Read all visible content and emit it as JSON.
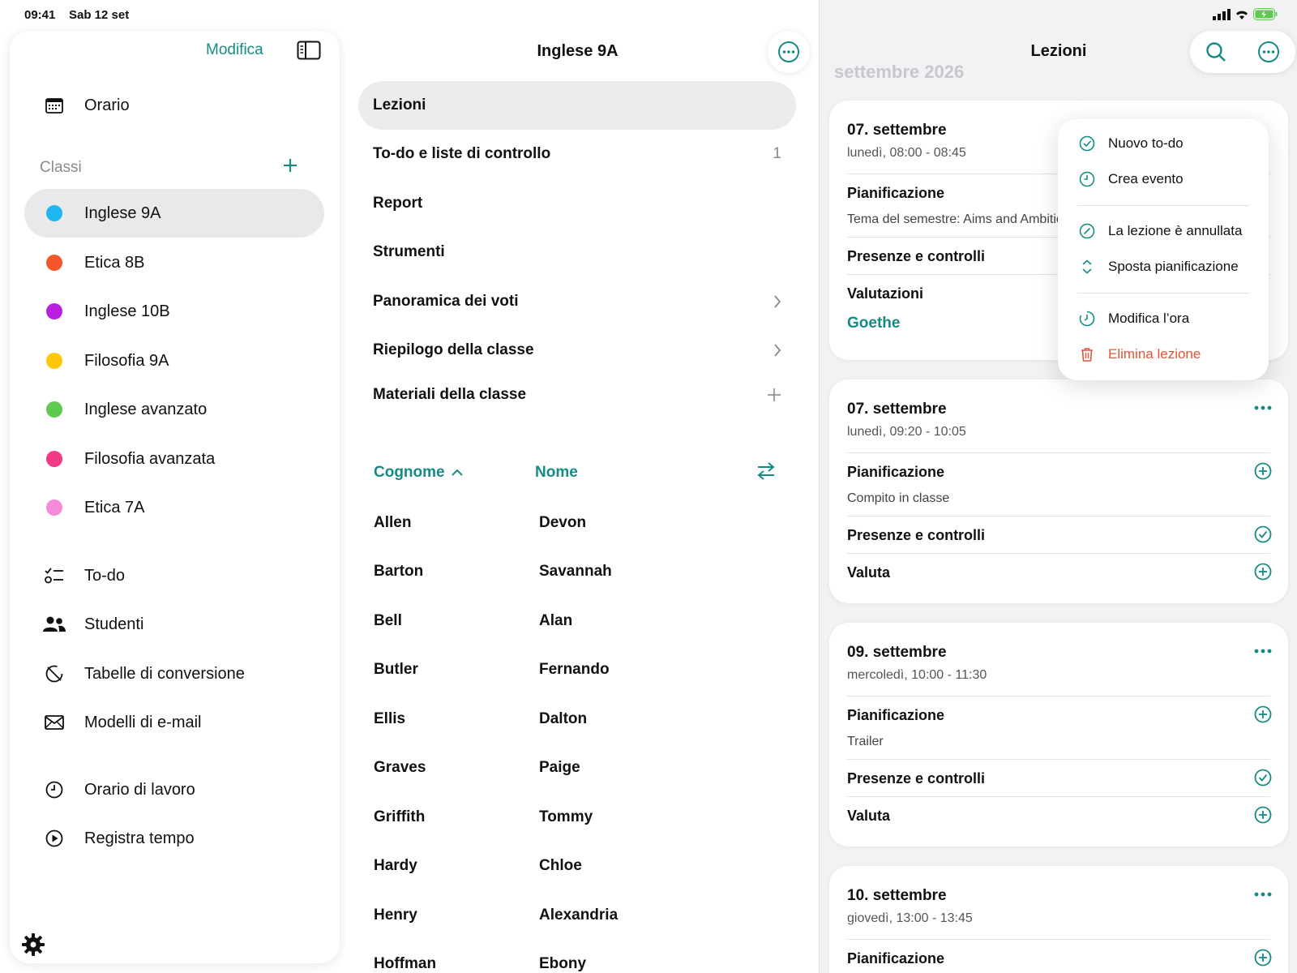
{
  "status": {
    "time": "09:41",
    "date": "Sab 12 set"
  },
  "sidebar": {
    "edit_label": "Modifica",
    "top_items": [
      {
        "label": "Orario",
        "icon": "calendar-icon"
      }
    ],
    "classes_title": "Classi",
    "classes": [
      {
        "label": "Inglese 9A",
        "color": "#1eb5f0",
        "selected": true
      },
      {
        "label": "Etica 8B",
        "color": "#f5562a"
      },
      {
        "label": "Inglese 10B",
        "color": "#b81fe0"
      },
      {
        "label": "Filosofia 9A",
        "color": "#ffc60a"
      },
      {
        "label": "Inglese avanzato",
        "color": "#5ecb50"
      },
      {
        "label": "Filosofia avanzata",
        "color": "#f23a86"
      },
      {
        "label": "Etica 7A",
        "color": "#f58bd8"
      }
    ],
    "tools": [
      {
        "label": "To-do",
        "icon": "checklist-icon"
      },
      {
        "label": "Studenti",
        "icon": "people-icon"
      },
      {
        "label": "Tabelle di conversione",
        "icon": "conversion-icon"
      },
      {
        "label": "Modelli di e-mail",
        "icon": "envelope-icon"
      }
    ],
    "time_items": [
      {
        "label": "Orario di lavoro",
        "icon": "clock-icon"
      },
      {
        "label": "Registra tempo",
        "icon": "play-icon"
      }
    ]
  },
  "middle": {
    "title": "Inglese 9A",
    "menu": [
      {
        "label": "Lezioni",
        "selected": true
      },
      {
        "label": "To-do e liste di controllo",
        "count": "1"
      },
      {
        "label": "Report"
      },
      {
        "label": "Strumenti"
      },
      {
        "label": "Panoramica dei voti"
      },
      {
        "label": "Riepilogo della classe"
      },
      {
        "label": "Materiali della classe"
      }
    ],
    "columns": {
      "last": "Cognome",
      "first": "Nome"
    },
    "students": [
      {
        "last": "Allen",
        "first": "Devon"
      },
      {
        "last": "Barton",
        "first": "Savannah"
      },
      {
        "last": "Bell",
        "first": "Alan"
      },
      {
        "last": "Butler",
        "first": "Fernando"
      },
      {
        "last": "Ellis",
        "first": "Dalton"
      },
      {
        "last": "Graves",
        "first": "Paige"
      },
      {
        "last": "Griffith",
        "first": "Tommy"
      },
      {
        "last": "Hardy",
        "first": "Chloe"
      },
      {
        "last": "Henry",
        "first": "Alexandria"
      },
      {
        "last": "Hoffman",
        "first": "Ebony"
      }
    ]
  },
  "right": {
    "title": "Lezioni",
    "month": "settembre 2026",
    "lessons": [
      {
        "date": "07. settembre",
        "time": "lunedì, 08:00 - 08:45",
        "planning_label": "Pianificazione",
        "planning_text": "Tema del semestre: Aims and Ambitions",
        "attendance_label": "Presenze e controlli",
        "grade_label": "Valutazioni",
        "grade_link": "Goethe"
      },
      {
        "date": "07. settembre",
        "time": "lunedì, 09:20 - 10:05",
        "planning_label": "Pianificazione",
        "planning_text": "Compito in classe",
        "attendance_label": "Presenze e controlli",
        "grade_label": "Valuta"
      },
      {
        "date": "09. settembre",
        "time": "mercoledì, 10:00 - 11:30",
        "planning_label": "Pianificazione",
        "planning_text": "Trailer",
        "attendance_label": "Presenze e controlli",
        "grade_label": "Valuta"
      },
      {
        "date": "10. settembre",
        "time": "giovedì, 13:00 - 13:45",
        "planning_label": "Pianificazione"
      }
    ]
  },
  "popover": {
    "items": [
      {
        "label": "Nuovo to-do",
        "icon": "check-circle-icon"
      },
      {
        "label": "Crea evento",
        "icon": "clock-icon"
      },
      {
        "label": "La lezione è annullata",
        "icon": "cancel-circle-icon"
      },
      {
        "label": "Sposta pianificazione",
        "icon": "up-down-chevron-icon"
      },
      {
        "label": "Modifica l’ora",
        "icon": "timer-icon"
      },
      {
        "label": "Elimina lezione",
        "icon": "trash-icon",
        "danger": true
      }
    ]
  },
  "colors": {
    "accent": "#168b85",
    "danger": "#e5533a"
  }
}
